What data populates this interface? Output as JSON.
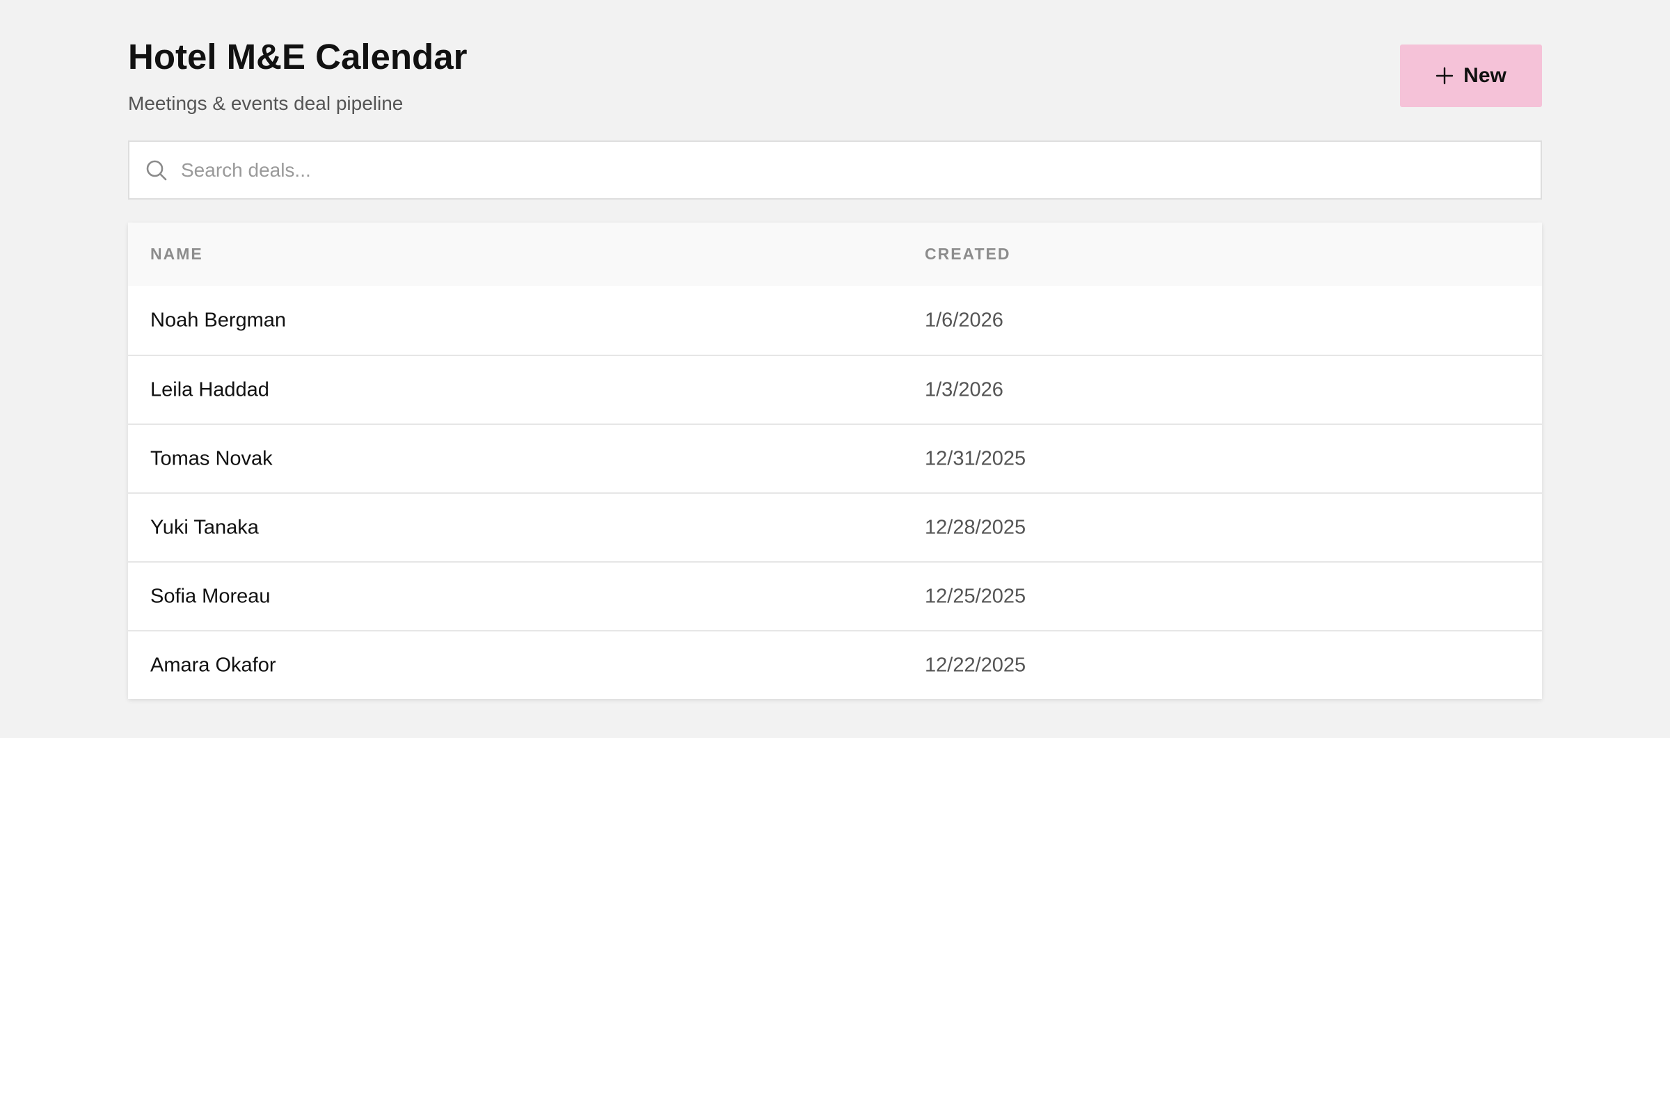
{
  "header": {
    "title": "Hotel M&E Calendar",
    "subtitle": "Meetings & events deal pipeline",
    "new_button_label": "New"
  },
  "search": {
    "placeholder": "Search deals...",
    "value": ""
  },
  "table": {
    "columns": [
      "NAME",
      "CREATED"
    ],
    "rows": [
      {
        "name": "Noah Bergman",
        "created": "1/6/2026"
      },
      {
        "name": "Leila Haddad",
        "created": "1/3/2026"
      },
      {
        "name": "Tomas Novak",
        "created": "12/31/2025"
      },
      {
        "name": "Yuki Tanaka",
        "created": "12/28/2025"
      },
      {
        "name": "Sofia Moreau",
        "created": "12/25/2025"
      },
      {
        "name": "Amara Okafor",
        "created": "12/22/2025"
      }
    ]
  },
  "icons": {
    "new_button": "plus-icon",
    "search": "search-icon"
  },
  "colors": {
    "accent_button": "#f5c2d8",
    "page_background": "#f2f2f2"
  }
}
